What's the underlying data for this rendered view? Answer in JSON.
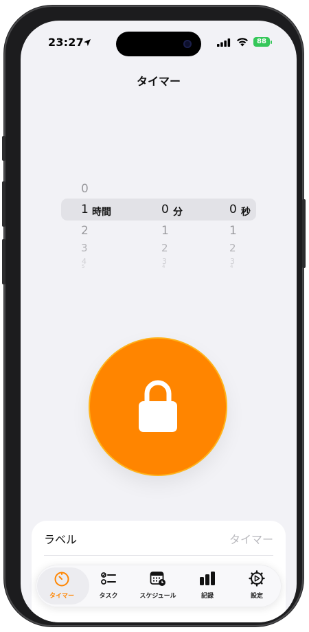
{
  "status_bar": {
    "time": "23:27",
    "battery": "88"
  },
  "header": {
    "title": "タイマー"
  },
  "picker": {
    "hours": {
      "above": [
        "0"
      ],
      "selected": "1",
      "unit": "時間",
      "below": [
        "2",
        "3",
        "4",
        "5"
      ]
    },
    "minutes": {
      "selected": "0",
      "unit": "分",
      "below": [
        "1",
        "2",
        "3",
        "4"
      ]
    },
    "seconds": {
      "selected": "0",
      "unit": "秒",
      "below": [
        "1",
        "2",
        "3",
        "4"
      ]
    }
  },
  "label_row": {
    "label": "ラベル",
    "value": "タイマー"
  },
  "tabs": [
    {
      "label": "タイマー",
      "icon": "timer-icon",
      "active": true
    },
    {
      "label": "タスク",
      "icon": "task-list-icon",
      "active": false
    },
    {
      "label": "スケジュール",
      "icon": "calendar-clock-icon",
      "active": false
    },
    {
      "label": "記録",
      "icon": "bar-chart-icon",
      "active": false
    },
    {
      "label": "設定",
      "icon": "settings-gear-icon",
      "active": false
    }
  ],
  "colors": {
    "accent": "#ff8500",
    "background": "#f2f2f6",
    "battery": "#35c759"
  }
}
